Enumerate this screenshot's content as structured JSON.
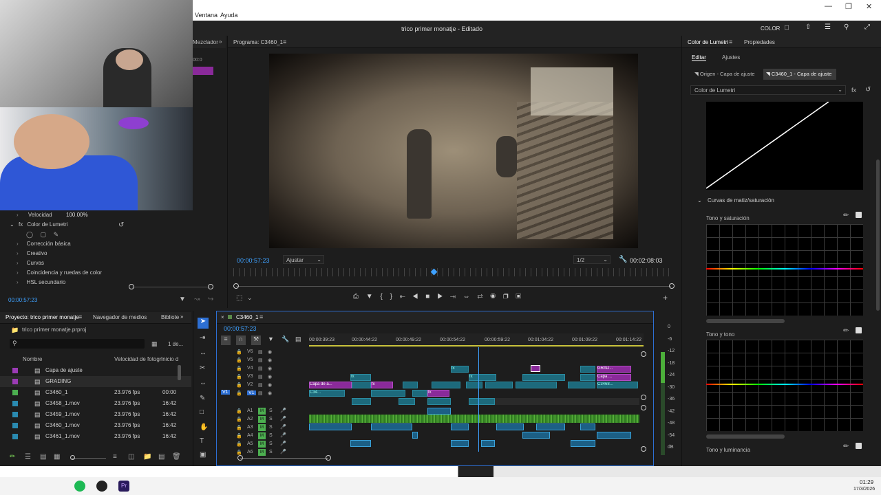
{
  "menu": {
    "items": [
      "Ventana",
      "Ayuda"
    ]
  },
  "window": {
    "title": "trico primer monatje - Editado",
    "workspace": "COLOR"
  },
  "effect_controls": {
    "tab_label": "Mezclador",
    "header_value": "00:0",
    "velocity_label": "Velocidad",
    "velocity_value": "100.00%",
    "lumetri_label": "Color de Lumetri",
    "sections": [
      "Corrección básica",
      "Creativo",
      "Curvas",
      "Coincidencia y ruedas de color",
      "HSL secundario"
    ],
    "timecode": "00:00:57:23"
  },
  "program": {
    "title": "Programa: C3460_1",
    "timecode": "00:00:57:23",
    "fit": "Ajustar",
    "quality": "1/2",
    "duration": "00:02:08:03",
    "playhead_fraction": 0.45
  },
  "lumetri": {
    "tab_color": "Color de Lumetri",
    "tab_props": "Propiedades",
    "subtab_edit": "Editar",
    "subtab_settings": "Ajustes",
    "source_label": "Origen - Capa de ajuste",
    "target_label": "C3460_1 - Capa de ajuste",
    "effect_select": "Color de Lumetri",
    "hue_sat_curves": "Curvas de matiz/saturación",
    "curve1": "Tono y saturación",
    "curve2": "Tono y tono",
    "curve3": "Tono y luminancia"
  },
  "project": {
    "tab_project": "Proyecto: trico primer monatje",
    "tab_media": "Navegador de medios",
    "tab_lib": "Bibliote",
    "file": "trico primer monatje.prproj",
    "count": "1 de...",
    "col_name": "Nombre",
    "col_fps": "Velocidad de fotogr",
    "col_start": "Inicio d",
    "rows": [
      {
        "name": "Capa de ajuste",
        "fps": "",
        "start": "",
        "color": "#9b3bb5"
      },
      {
        "name": "GRADING",
        "fps": "",
        "start": "",
        "color": "#9b3bb5"
      },
      {
        "name": "C3460_1",
        "fps": "23.976 fps",
        "start": "00:00",
        "color": "#4caf50"
      },
      {
        "name": "C3458_1.mov",
        "fps": "23.976 fps",
        "start": "16:42",
        "color": "#2a8ab0"
      },
      {
        "name": "C3459_1.mov",
        "fps": "23.976 fps",
        "start": "16:42",
        "color": "#2a8ab0"
      },
      {
        "name": "C3460_1.mov",
        "fps": "23.976 fps",
        "start": "16:42",
        "color": "#2a8ab0"
      },
      {
        "name": "C3461_1.mov",
        "fps": "23.976 fps",
        "start": "16:42",
        "color": "#2a8ab0"
      }
    ]
  },
  "timeline": {
    "tab": "C3460_1",
    "timecode": "00:00:57:23",
    "ruler": [
      "00:00:39:23",
      "00:00:44:22",
      "00:00:49:22",
      "00:00:54:22",
      "00:00:59:22",
      "00:01:04:22",
      "00:01:09:22",
      "00:01:14:22"
    ],
    "video_tracks": [
      "V6",
      "V5",
      "V4",
      "V3",
      "V2",
      "V1"
    ],
    "audio_tracks": [
      "A1",
      "A2",
      "A3",
      "A4",
      "A5",
      "A6"
    ],
    "clip_labels": {
      "adj": "Capa de a...",
      "c34": "C34...",
      "grad": "GRAD...",
      "capa": "Capa ...",
      "c3468": "C3468...",
      "fx": "fx"
    }
  },
  "meters": {
    "labels": [
      "0",
      "-6",
      "-12",
      "-18",
      "-24",
      "-30",
      "-36",
      "-42",
      "-48",
      "-54",
      "dB"
    ]
  },
  "taskbar": {
    "time": "01:29",
    "date": "17/3/2026"
  },
  "colors": {
    "accent": "#3ea1ff",
    "clip_teal": "#1d6a7c",
    "clip_purple": "#8a2a9a",
    "audio_green": "#4caf3a"
  }
}
